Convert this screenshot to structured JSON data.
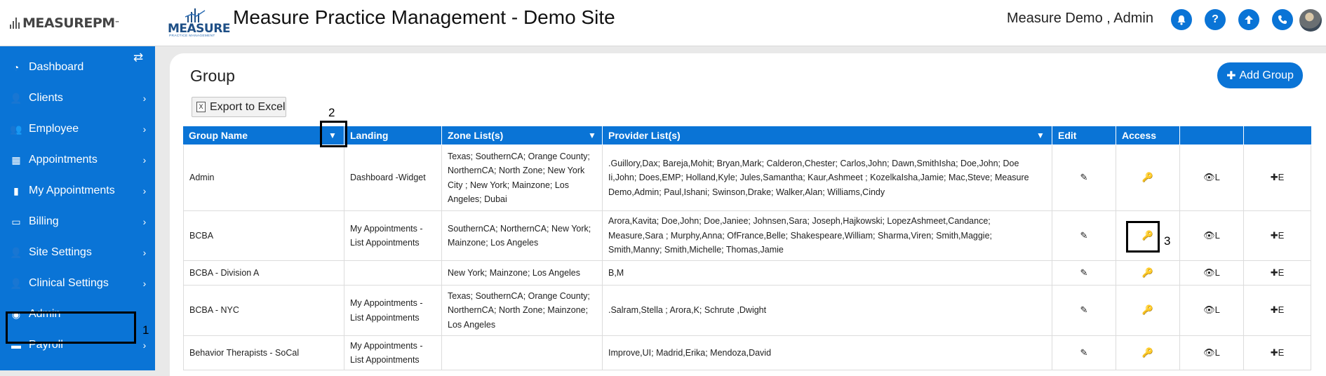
{
  "header": {
    "brand": "MEASUREPM",
    "logo_word": "MEASURE",
    "logo_sub": "PRACTICE MANAGEMENT",
    "site_title": "Measure Practice Management - Demo Site",
    "user_name": "Measure Demo , Admin",
    "icons": [
      "bell-icon",
      "help-icon",
      "upload-icon",
      "phone-icon"
    ]
  },
  "sidebar": {
    "items": [
      {
        "label": "Dashboard",
        "icon": "dashboard-icon",
        "chevron": false
      },
      {
        "label": "Clients",
        "icon": "user-icon",
        "chevron": true
      },
      {
        "label": "Employee",
        "icon": "users-icon",
        "chevron": true
      },
      {
        "label": "Appointments",
        "icon": "calendar-icon",
        "chevron": true
      },
      {
        "label": "My Appointments",
        "icon": "book-icon",
        "chevron": true
      },
      {
        "label": "Billing",
        "icon": "money-icon",
        "chevron": true
      },
      {
        "label": "Site Settings",
        "icon": "user-icon",
        "chevron": true
      },
      {
        "label": "Clinical Settings",
        "icon": "user-icon",
        "chevron": true
      },
      {
        "label": "Admin",
        "icon": "user-circle-icon",
        "chevron": false
      },
      {
        "label": "Payroll",
        "icon": "card-icon",
        "chevron": true
      }
    ]
  },
  "page": {
    "title": "Group",
    "add_button": "Add Group",
    "export_button": "Export to Excel"
  },
  "table": {
    "columns": [
      "Group Name",
      "Landing",
      "Zone List(s)",
      "Provider List(s)",
      "Edit",
      "Access",
      "",
      ""
    ],
    "rows": [
      {
        "group": "Admin",
        "landing": "Dashboard -Widget",
        "zones": "Texas; SouthernCA; Orange County; NorthernCA; North Zone; New York City ; New York; Mainzone; Los Angeles; Dubai",
        "providers": ".Guillory,Dax; Bareja,Mohit; Bryan,Mark; Calderon,Chester; Carlos,John; Dawn,SmithIsha; Doe,John; Doe Ii,John; Does,EMP; Holland,Kyle; Jules,Samantha; Kaur,Ashmeet ; KozelkaIsha,Jamie; Mac,Steve; Measure Demo,Admin; Paul,Ishani; Swinson,Drake; Walker,Alan; Williams,Cindy"
      },
      {
        "group": "BCBA",
        "landing": "My Appointments - List Appointments",
        "zones": "SouthernCA; NorthernCA; New York; Mainzone; Los Angeles",
        "providers": "Arora,Kavita; Doe,John; Doe,Janiee; Johnsen,Sara; Joseph,Hajkowski; LopezAshmeet,Candance; Measure,Sara ; Murphy,Anna; OfFrance,Belle; Shakespeare,William; Sharma,Viren; Smith,Maggie; Smith,Manny; Smith,Michelle; Thomas,Jamie"
      },
      {
        "group": "BCBA - Division A",
        "landing": "",
        "zones": "New York; Mainzone; Los Angeles",
        "providers": "B,M"
      },
      {
        "group": "BCBA - NYC",
        "landing": "My Appointments - List Appointments",
        "zones": "Texas; SouthernCA; Orange County; NorthernCA; North Zone; Mainzone; Los Angeles",
        "providers": ".Salram,Stella ; Arora,K; Schrute ,Dwight"
      },
      {
        "group": "Behavior Therapists - SoCal",
        "landing": "My Appointments - List Appointments",
        "zones": "",
        "providers": "Improve,UI; Madrid,Erika; Mendoza,David"
      }
    ],
    "action_labels": {
      "edit": "✎",
      "access": "🔑",
      "view": "👁L",
      "add": "✚E"
    }
  },
  "annotations": [
    "1",
    "2",
    "3"
  ]
}
